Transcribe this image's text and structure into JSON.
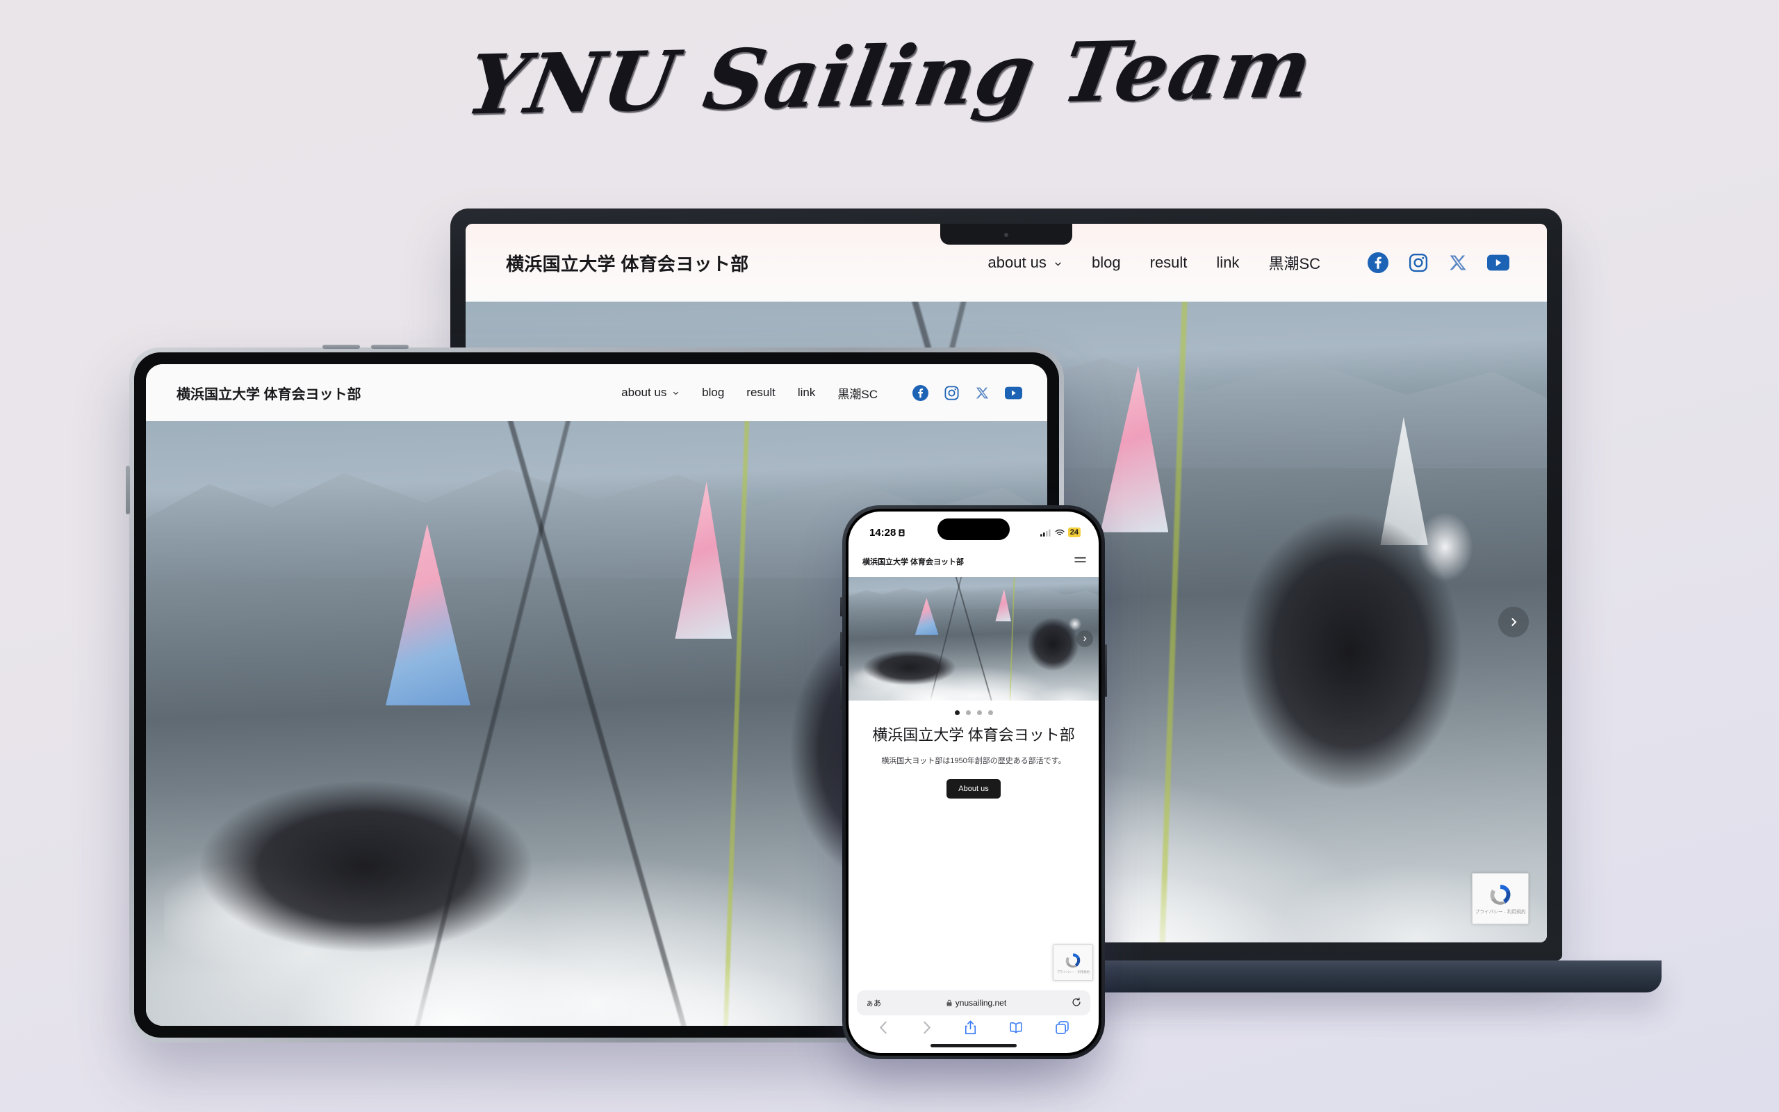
{
  "headline": {
    "text": "YNU Sailing Team"
  },
  "site": {
    "title": "横浜国立大学 体育会ヨット部",
    "nav": [
      {
        "label": "about us",
        "has_chevron": true
      },
      {
        "label": "blog",
        "has_chevron": false
      },
      {
        "label": "result",
        "has_chevron": false
      },
      {
        "label": "link",
        "has_chevron": false
      },
      {
        "label": "黒潮SC",
        "has_chevron": false
      }
    ],
    "social": [
      {
        "name": "facebook-icon"
      },
      {
        "name": "instagram-icon"
      },
      {
        "name": "x-icon"
      },
      {
        "name": "youtube-icon"
      }
    ],
    "accent_color": "#1d63b5"
  },
  "hero": {
    "heading": "横浜国立大学 体育会ヨット部",
    "subtext": "横浜国大ヨット部は1950年創部の歴史ある部活です。",
    "cta_label": "About us",
    "carousel_dots": 4,
    "carousel_active_index": 0,
    "next_arrow_icon": "chevron-right-icon"
  },
  "recaptcha": {
    "text": "プライバシー - 利用規約"
  },
  "phone": {
    "status": {
      "time": "14:28",
      "time_badge_icon": "focus-icon",
      "signal_icon": "cellular-signal-icon",
      "wifi_icon": "wifi-icon",
      "battery_percent": "24"
    },
    "menu_icon": "hamburger-menu-icon",
    "safari": {
      "text_size_label": "ぁあ",
      "lock_icon": "lock-icon",
      "url": "ynusailing.net",
      "reload_icon": "reload-icon",
      "toolbar": [
        {
          "name": "back-icon"
        },
        {
          "name": "forward-icon"
        },
        {
          "name": "share-icon"
        },
        {
          "name": "bookmarks-icon"
        },
        {
          "name": "tabs-icon"
        }
      ]
    }
  },
  "background": {
    "color_top": "#eae5e9",
    "color_bottom": "#dedeec"
  }
}
